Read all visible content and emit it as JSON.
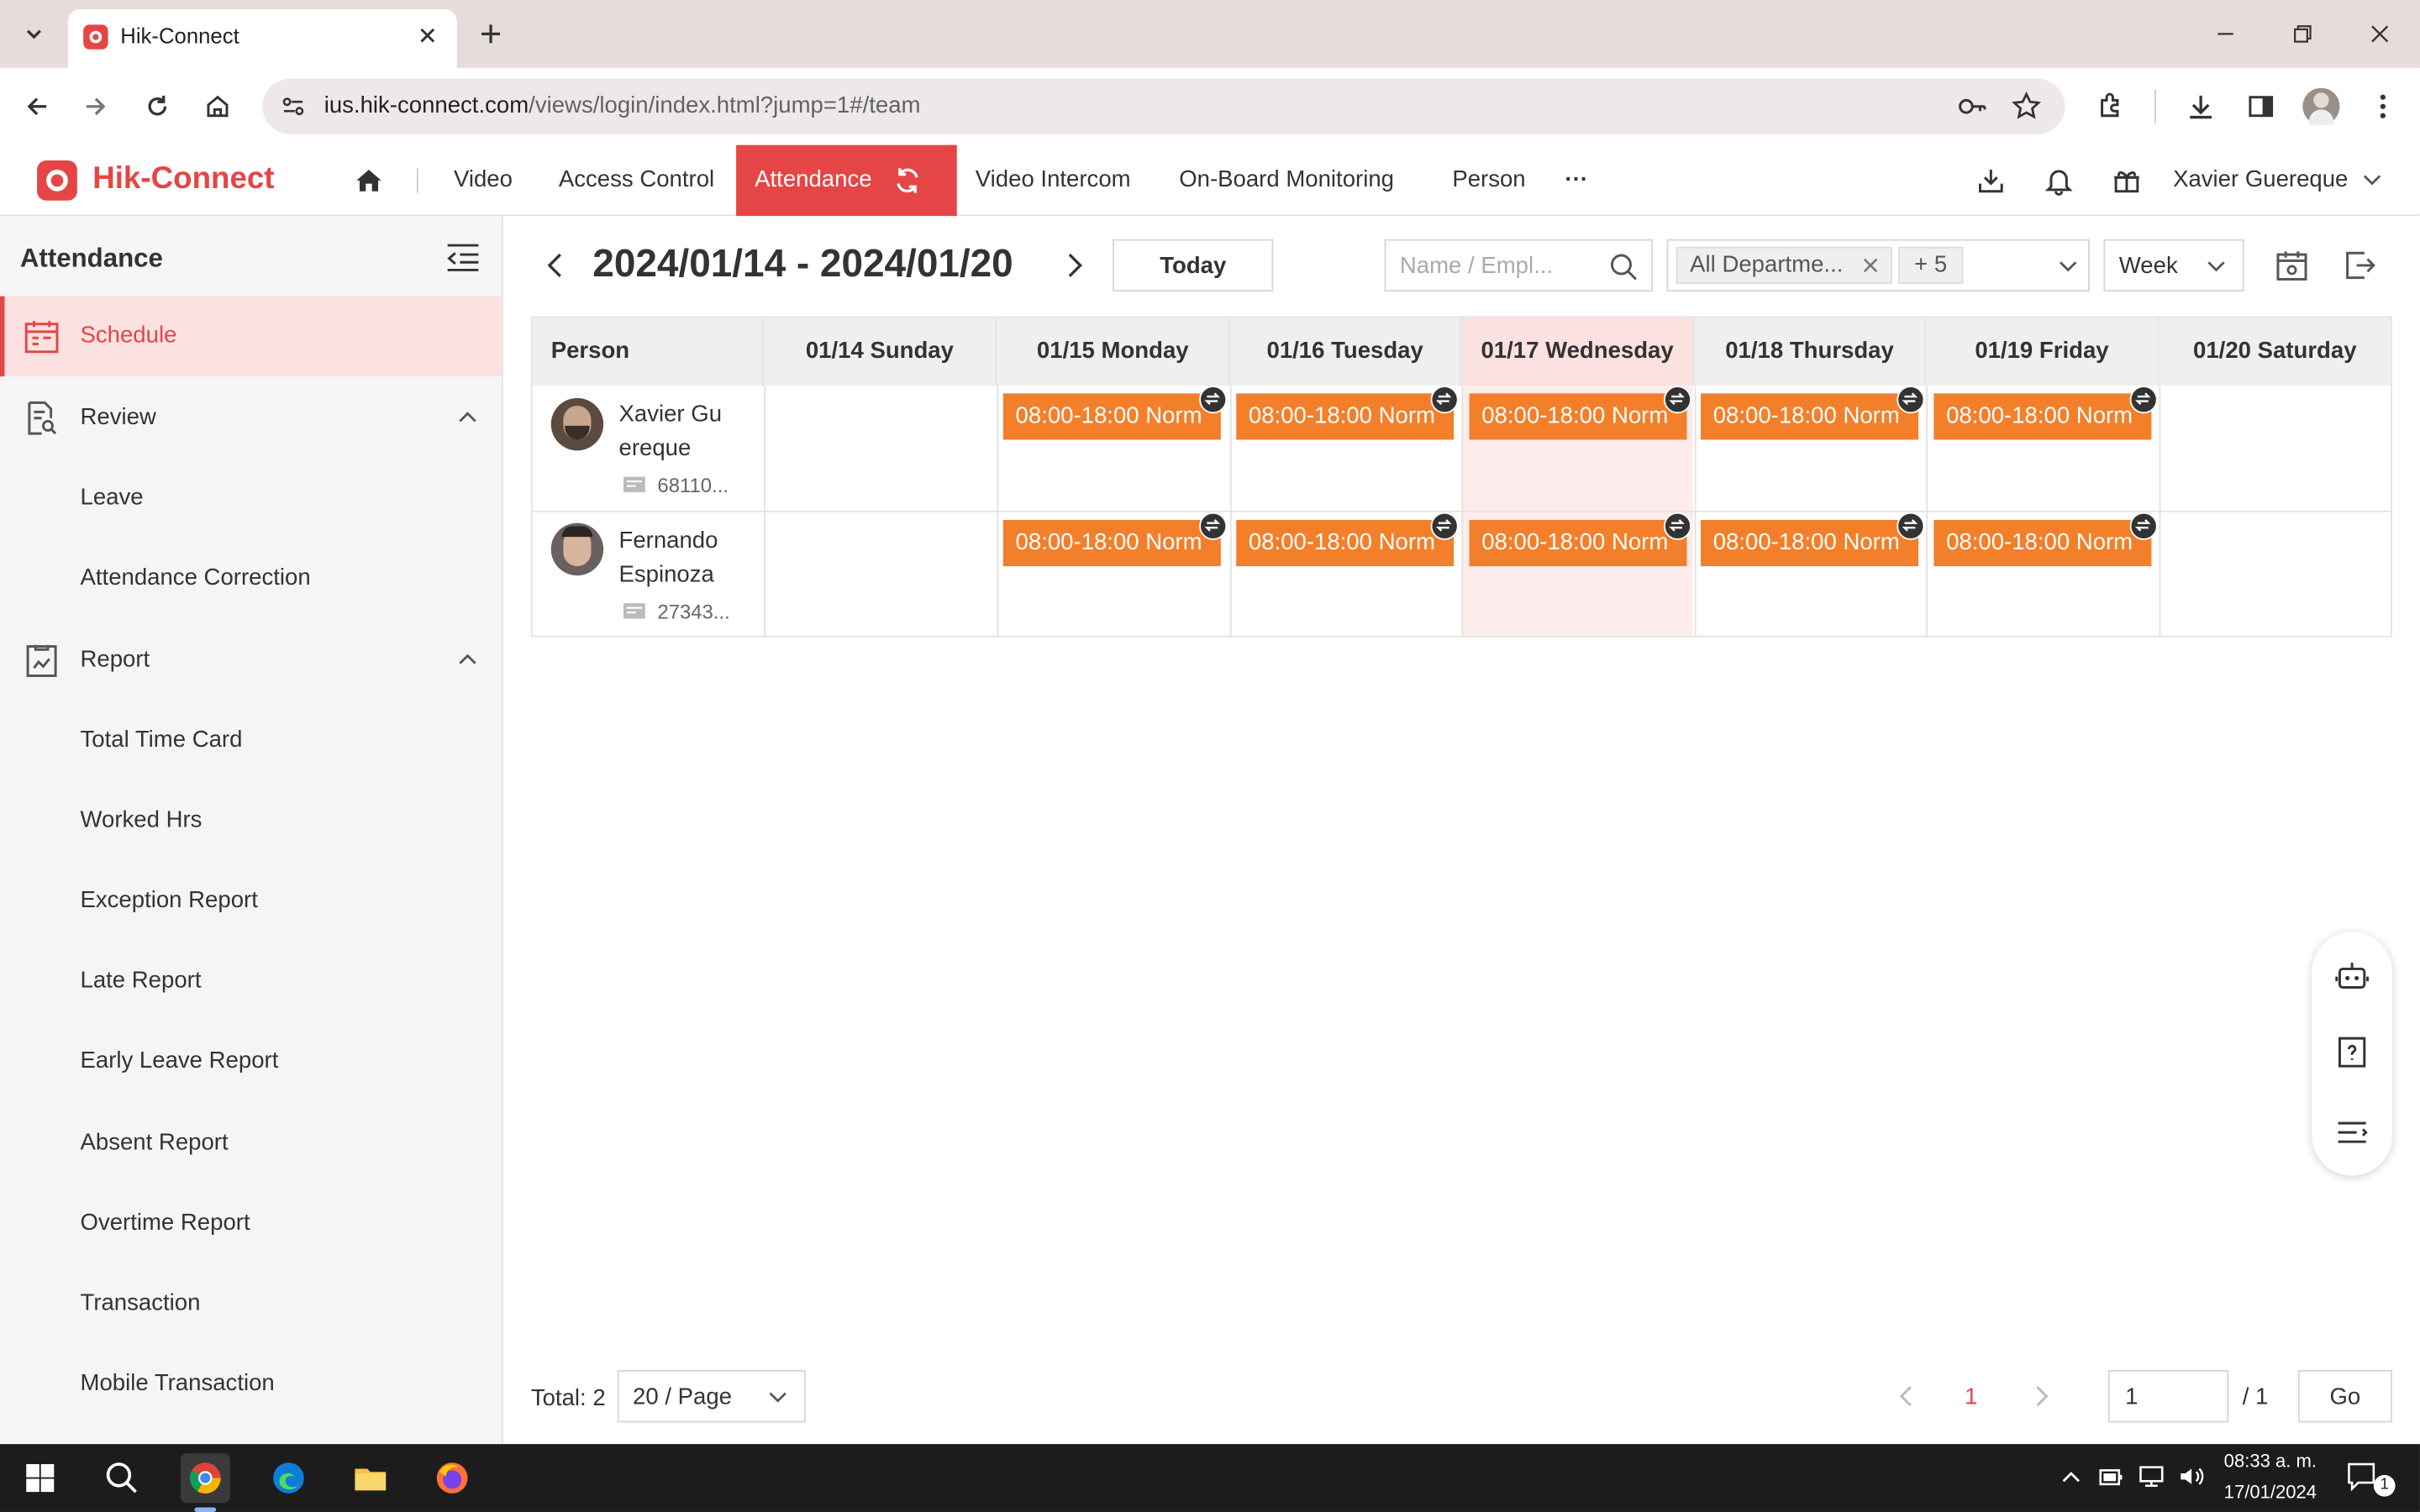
{
  "browser": {
    "tab_title": "Hik-Connect",
    "url_host": "ius.hik-connect.com",
    "url_path": "/views/login/index.html?jump=1#/team"
  },
  "app": {
    "brand": "Hik-Connect",
    "nav": [
      "Video",
      "Access Control",
      "Attendance",
      "Video Intercom",
      "On-Board Monitoring",
      "Person"
    ],
    "more": "···",
    "user": "Xavier Guereque",
    "accent": "#e64545",
    "shift_color": "#f47f2a"
  },
  "sidebar": {
    "title": "Attendance",
    "schedule": "Schedule",
    "review": "Review",
    "review_items": [
      "Leave",
      "Attendance Correction"
    ],
    "report": "Report",
    "report_items": [
      "Total Time Card",
      "Worked Hrs",
      "Exception Report",
      "Late Report",
      "Early Leave Report",
      "Absent Report",
      "Overtime Report",
      "Transaction",
      "Mobile Transaction"
    ]
  },
  "toolbar": {
    "range": "2024/01/14 - 2024/01/20",
    "today": "Today",
    "search_placeholder": "Name / Empl...",
    "dept": "All Departme...",
    "dept_more": "+ 5",
    "view": "Week"
  },
  "grid": {
    "person_header": "Person",
    "days": [
      "01/14 Sunday",
      "01/15 Monday",
      "01/16 Tuesday",
      "01/17 Wednesday",
      "01/18 Thursday",
      "01/19 Friday",
      "01/20 Saturday"
    ],
    "rows": [
      {
        "name1": "Xavier Gu",
        "name2": "ereque",
        "id": "68110..."
      },
      {
        "name1": "Fernando",
        "name2": "Espinoza",
        "id": "27343..."
      }
    ],
    "shift": "08:00-18:00 Norm"
  },
  "footer": {
    "total": "Total: 2",
    "page_size": "20 / Page",
    "page": "1",
    "page_input": "1",
    "of": "/ 1",
    "go": "Go"
  },
  "taskbar": {
    "time": "08:33 a. m.",
    "date": "17/01/2024",
    "notif": "1"
  }
}
